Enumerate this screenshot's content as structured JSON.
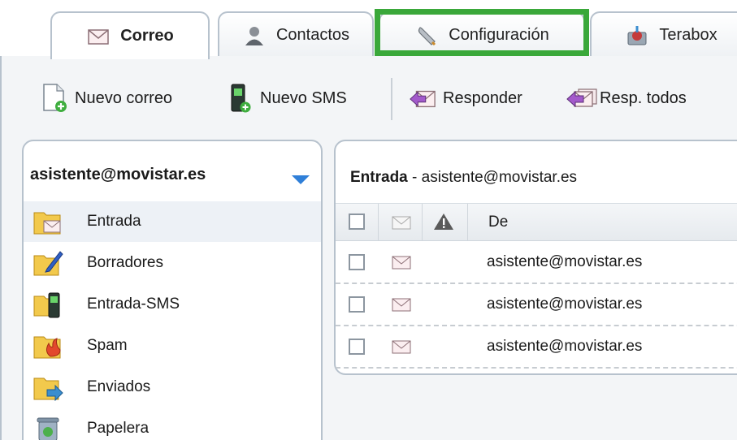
{
  "tabs": [
    {
      "label": "Correo",
      "icon": "mail-icon",
      "active": true
    },
    {
      "label": "Contactos",
      "icon": "contacts-icon",
      "active": false
    },
    {
      "label": "Configuración",
      "icon": "wrench-icon",
      "active": false,
      "highlighted": true
    },
    {
      "label": "Terabox",
      "icon": "terabox-icon",
      "active": false
    }
  ],
  "toolbar": {
    "new_mail": "Nuevo correo",
    "new_sms": "Nuevo SMS",
    "reply": "Responder",
    "reply_all": "Resp. todos"
  },
  "sidebar": {
    "account": "asistente@movistar.es",
    "folders": [
      {
        "label": "Entrada",
        "icon": "inbox-folder-icon",
        "active": true
      },
      {
        "label": "Borradores",
        "icon": "drafts-folder-icon",
        "active": false
      },
      {
        "label": "Entrada-SMS",
        "icon": "sms-folder-icon",
        "active": false
      },
      {
        "label": "Spam",
        "icon": "spam-folder-icon",
        "active": false
      },
      {
        "label": "Enviados",
        "icon": "sent-folder-icon",
        "active": false
      },
      {
        "label": "Papelera",
        "icon": "trash-icon",
        "active": false
      }
    ]
  },
  "inbox": {
    "folder_name": "Entrada",
    "title_suffix": " - asistente@movistar.es",
    "columns": {
      "from": "De"
    },
    "messages": [
      {
        "from": "asistente@movistar.es"
      },
      {
        "from": "asistente@movistar.es"
      },
      {
        "from": "asistente@movistar.es"
      }
    ]
  },
  "colors": {
    "highlight": "#3aa83a",
    "accent": "#2f7fd8",
    "border": "#b7c2cd"
  }
}
